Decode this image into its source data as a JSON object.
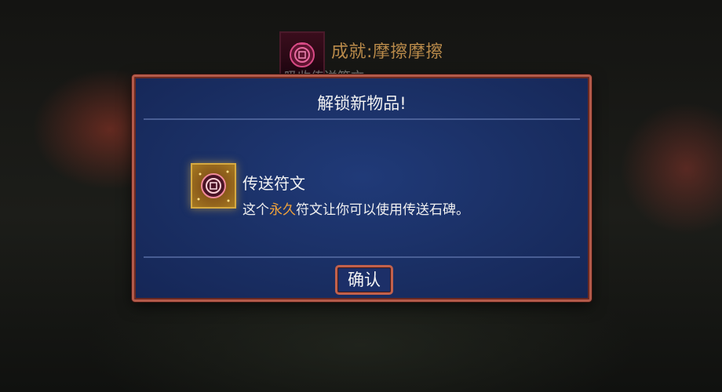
{
  "achievement": {
    "title": "成就:摩擦摩擦",
    "subtitle": "吸收传送符文"
  },
  "dialog": {
    "title": "解锁新物品!",
    "item": {
      "icon": "teleport-rune-icon",
      "name": "传送符文",
      "description_prefix": "这个",
      "description_highlight": "永久",
      "description_suffix": "符文让你可以使用传送石碑。"
    },
    "confirm_label": "确认"
  },
  "colors": {
    "dialog_background": "#1a2f64",
    "dialog_border": "#b35a4a",
    "highlight_text": "#f2a33a",
    "achievement_title": "#b98a4a"
  }
}
